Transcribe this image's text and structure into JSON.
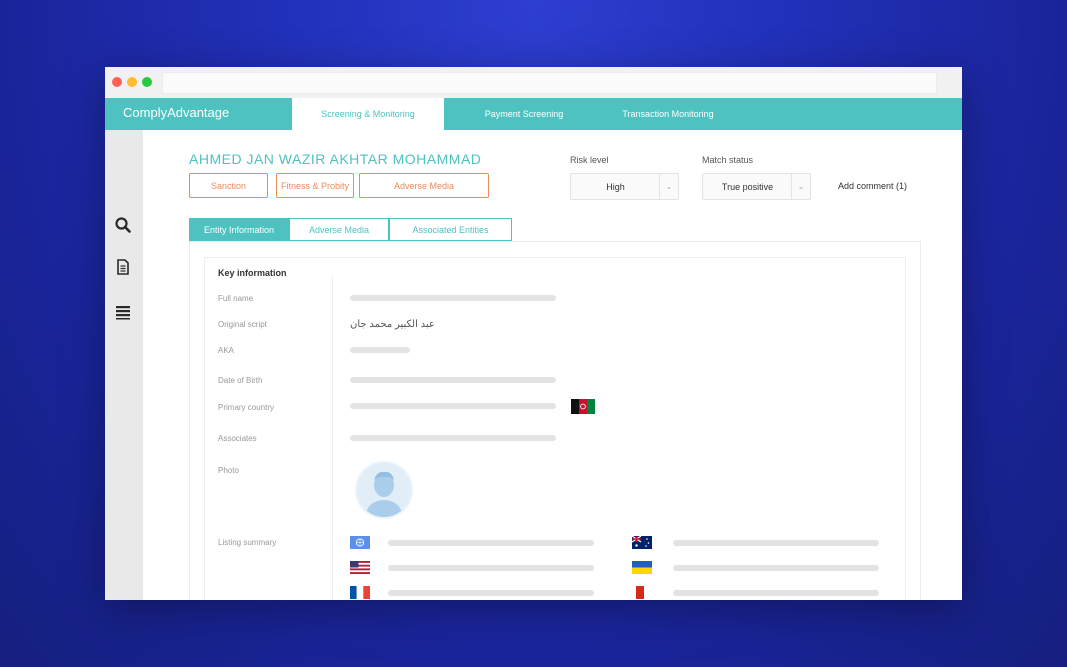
{
  "app": {
    "brand": "ComplyAdvantage"
  },
  "topnav": [
    {
      "label": "Screening & Monitoring",
      "active": true
    },
    {
      "label": "Payment Screening",
      "active": false
    },
    {
      "label": "Transaction Monitoring",
      "active": false
    }
  ],
  "sidebar": {
    "icons": [
      "search-icon",
      "document-icon",
      "list-icon"
    ]
  },
  "entity": {
    "name": "AHMED JAN WAZIR AKHTAR MOHAMMAD",
    "tags": [
      "Sanction",
      "Fitness & Probity",
      "Adverse Media"
    ]
  },
  "risk": {
    "label": "Risk level",
    "value": "High"
  },
  "match": {
    "label": "Match status",
    "value": "True positive"
  },
  "comment": {
    "label": "Add comment (1)"
  },
  "tabs": [
    {
      "label": "Entity Information",
      "active": true
    },
    {
      "label": "Adverse Media",
      "active": false
    },
    {
      "label": "Associated Entities",
      "active": false
    }
  ],
  "key_info": {
    "title": "Key information",
    "fields": {
      "full_name": "Full name",
      "original_script": "Original script",
      "aka": "AKA",
      "dob": "Date of Birth",
      "primary_country": "Primary country",
      "associates": "Associates",
      "photo": "Photo",
      "listing_summary": "Listing summary"
    },
    "original_script_value": "عبد الكبير محمد جان"
  },
  "colors": {
    "accent": "#4ec2c1",
    "tag_orange": "#ef8a5a",
    "background": "#2130b8"
  }
}
